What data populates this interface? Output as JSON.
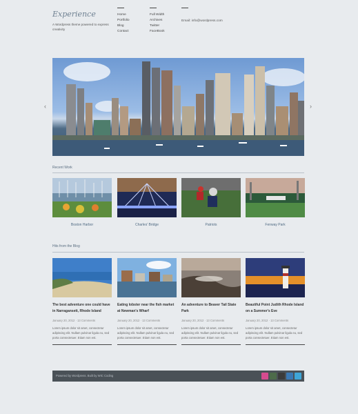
{
  "site": {
    "logo": "Experience",
    "tagline": "A Wordpress theme powered to express creativity"
  },
  "nav": {
    "col1": [
      "Home",
      "Portfolio",
      "Blog",
      "Contact"
    ],
    "col2": [
      "Full Width",
      "Archives",
      "Twitter",
      "FaceBook"
    ],
    "email": "Email: info@wordpress.com"
  },
  "slider": {
    "prev": "‹",
    "next": "›"
  },
  "recent_work": {
    "title": "Recent Work",
    "items": [
      "Boston Harbor",
      "Charles' Bridge",
      "Patriots",
      "Fenway Park"
    ]
  },
  "blog": {
    "title": "Hits from the Blog",
    "posts": [
      {
        "title": "The best adventure one could have in Narragansett, Rhode Island",
        "meta": "January 20, 2012 · 13 Comments",
        "excerpt": "Lorem ipsum dolor sit amet, consectetur adipiscing elit. Nullam pulvinar ligula eu, sed porta consectetuer. Etiam non est."
      },
      {
        "title": "Eating lobster near the fish market at Newman's Wharf",
        "meta": "January 20, 2012 · 13 Comments",
        "excerpt": "Lorem ipsum dolor sit amet, consectetur adipiscing elit. Nullam pulvinar ligula eu, sed porta consectetuer. Etiam non est."
      },
      {
        "title": "An adventure to Beaver Tail State Park",
        "meta": "January 20, 2012 · 13 Comments",
        "excerpt": "Lorem ipsum dolor sit amet, consectetur adipiscing elit. Nullam pulvinar ligula eu, sed porta consectetuer. Etiam non est."
      },
      {
        "title": "Beautiful Point Judith Rhode Island on a Summer's Eve",
        "meta": "January 20, 2012 · 13 Comments",
        "excerpt": "Lorem ipsum dolor sit amet, consectetur adipiscing elit. Nullam pulvinar ligula eu, sed porta consectetuer. Etiam non est."
      }
    ]
  },
  "footer": {
    "text": "Powered by Wordpress. Built by WIC Coding",
    "social": [
      "dribbble-icon",
      "deviantart-icon",
      "delicious-icon",
      "linkedin-icon",
      "twitter-icon"
    ],
    "social_colors": [
      "#d64b8f",
      "#4d6b4a",
      "#3b3b3b",
      "#3a78b4",
      "#3fa6d8"
    ]
  }
}
